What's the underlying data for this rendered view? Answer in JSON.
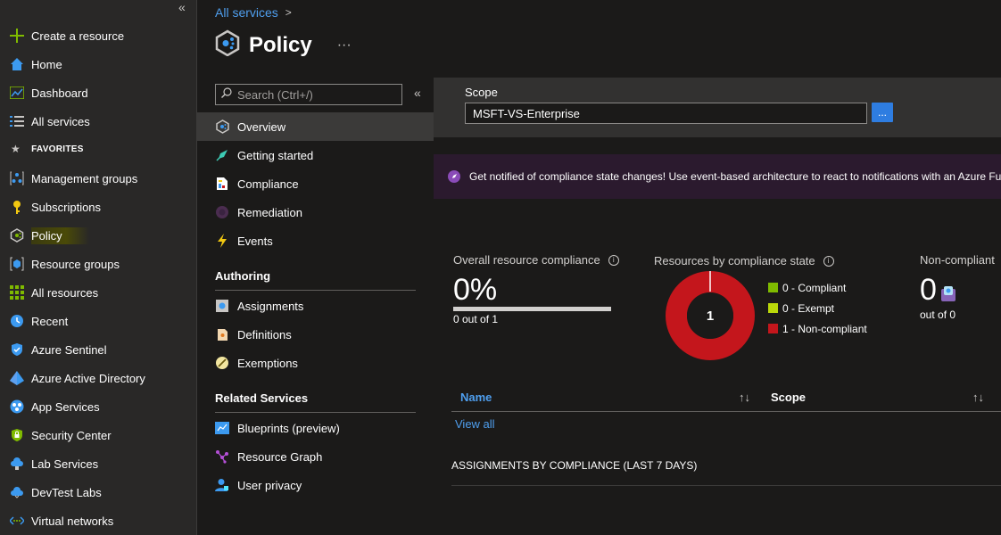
{
  "leftnav": {
    "create_resource": "Create a resource",
    "home": "Home",
    "dashboard": "Dashboard",
    "all_services": "All services",
    "favorites_header": "FAVORITES",
    "favorites": [
      "Management groups",
      "Subscriptions",
      "Policy",
      "Resource groups",
      "All resources",
      "Recent",
      "Azure Sentinel",
      "Azure Active Directory",
      "App Services",
      "Security Center",
      "Lab Services",
      "DevTest Labs",
      "Virtual networks"
    ],
    "collapse_glyph": "«"
  },
  "header": {
    "breadcrumb": "All services",
    "title": "Policy",
    "more": "···"
  },
  "menu": {
    "search_placeholder": "Search (Ctrl+/)",
    "collapse_glyph": "«",
    "main_items": [
      "Overview",
      "Getting started",
      "Compliance",
      "Remediation",
      "Events"
    ],
    "authoring_header": "Authoring",
    "authoring_items": [
      "Assignments",
      "Definitions",
      "Exemptions"
    ],
    "related_header": "Related Services",
    "related_items": [
      "Blueprints (preview)",
      "Resource Graph",
      "User privacy"
    ]
  },
  "scope": {
    "label": "Scope",
    "value": "MSFT-VS-Enterprise",
    "button": "..."
  },
  "banner": {
    "text": "Get notified of compliance state changes! Use event-based architecture to react to notifications with an Azure Fu"
  },
  "overall": {
    "title": "Overall resource compliance",
    "percent": "0%",
    "subtitle": "0 out of 1",
    "compliance_fraction": 0
  },
  "state": {
    "title": "Resources by compliance state",
    "center_value": "1",
    "legend": [
      {
        "label": "0 - Compliant",
        "color": "#7fba00"
      },
      {
        "label": "0 - Exempt",
        "color": "#bad80a"
      },
      {
        "label": "1 - Non-compliant",
        "color": "#c4161c"
      }
    ],
    "counts": {
      "compliant": 0,
      "exempt": 0,
      "non_compliant": 1
    }
  },
  "noncompliant": {
    "title": "Non-compliant",
    "value": "0",
    "subtitle": "out of 0"
  },
  "table": {
    "col_name": "Name",
    "col_scope": "Scope",
    "sort_glyph": "↑↓",
    "view_all": "View all"
  },
  "assignments_header": "ASSIGNMENTS BY COMPLIANCE (LAST 7 DAYS)",
  "colors": {
    "accent": "#2e7de1",
    "link": "#4f9fef",
    "non_compliant": "#c4161c",
    "banner_bg": "#2b1a2e"
  }
}
